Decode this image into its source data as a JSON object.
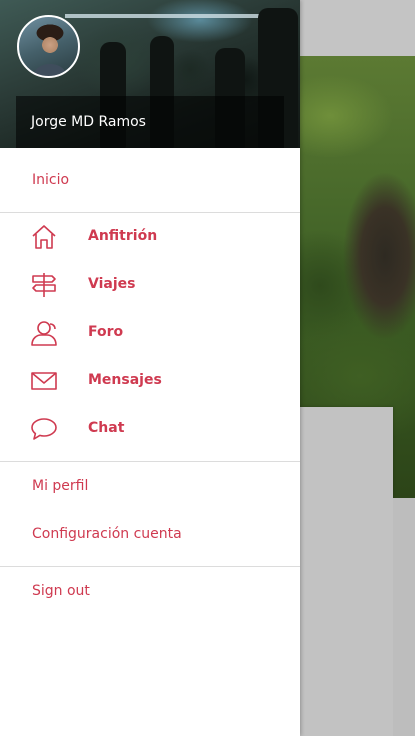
{
  "user": {
    "name": "Jorge MD Ramos"
  },
  "menu": {
    "home_label": "Inicio",
    "items": [
      {
        "label": "Anfitrión",
        "icon": "home-icon"
      },
      {
        "label": "Viajes",
        "icon": "signpost-icon"
      },
      {
        "label": "Foro",
        "icon": "users-icon"
      },
      {
        "label": "Mensajes",
        "icon": "envelope-icon"
      },
      {
        "label": "Chat",
        "icon": "chat-bubble-icon"
      }
    ],
    "profile_label": "Mi perfil",
    "settings_label": "Configuración cuenta",
    "signout_label": "Sign out"
  },
  "colors": {
    "accent": "#cf3a50",
    "divider": "#dcdcdc"
  }
}
